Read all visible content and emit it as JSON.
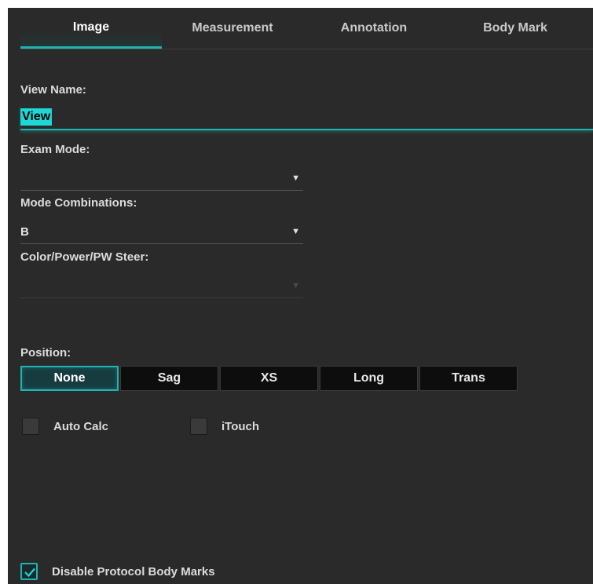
{
  "tabs": [
    {
      "label": "Image"
    },
    {
      "label": "Measurement"
    },
    {
      "label": "Annotation"
    },
    {
      "label": "Body Mark"
    }
  ],
  "view_name": {
    "label": "View Name:",
    "value": "View"
  },
  "exam_mode": {
    "label": "Exam Mode:",
    "value": ""
  },
  "mode_combinations": {
    "label": "Mode Combinations:",
    "value": "B"
  },
  "steer": {
    "label": "Color/Power/PW Steer:",
    "value": ""
  },
  "position": {
    "label": "Position:",
    "options": [
      {
        "label": "None"
      },
      {
        "label": "Sag"
      },
      {
        "label": "XS"
      },
      {
        "label": "Long"
      },
      {
        "label": "Trans"
      }
    ]
  },
  "auto_calc": {
    "label": "Auto Calc",
    "checked": false
  },
  "itouch": {
    "label": "iTouch",
    "checked": false
  },
  "disable_protocol": {
    "label": "Disable Protocol Body Marks",
    "checked": true
  },
  "colors": {
    "accent": "#1fb3b3",
    "panel": "#2a2a2a",
    "button": "#0d0d0d"
  },
  "icons": {
    "dropdown": "triangle-down-icon",
    "check": "check-icon"
  }
}
